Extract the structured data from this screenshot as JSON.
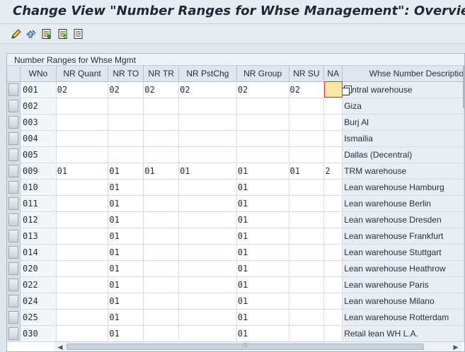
{
  "title": "Change View \"Number Ranges for Whse Management\": Overview",
  "toolbar": {
    "icons": [
      "pencil-glasses-icon",
      "other-view-icon",
      "details-icon",
      "select-all-icon",
      "deselect-icon"
    ]
  },
  "panel": {
    "title": "Number Ranges for Whse Mgmt",
    "columns": [
      "WNo",
      "NR Quant",
      "NR TO",
      "NR TR",
      "NR PstChg",
      "NR Group",
      "NR SU",
      "NA",
      "Whse Number Descriptio"
    ],
    "rows": [
      {
        "wno": "001",
        "nr_quant": "02",
        "nr_to": "02",
        "nr_tr": "02",
        "nr_pstchg": "02",
        "nr_group": "02",
        "nr_su": "02",
        "na": "",
        "desc": "ntral warehouse"
      },
      {
        "wno": "002",
        "nr_quant": "",
        "nr_to": "",
        "nr_tr": "",
        "nr_pstchg": "",
        "nr_group": "",
        "nr_su": "",
        "na": "",
        "desc": "Giza"
      },
      {
        "wno": "003",
        "nr_quant": "",
        "nr_to": "",
        "nr_tr": "",
        "nr_pstchg": "",
        "nr_group": "",
        "nr_su": "",
        "na": "",
        "desc": "Burj Al"
      },
      {
        "wno": "004",
        "nr_quant": "",
        "nr_to": "",
        "nr_tr": "",
        "nr_pstchg": "",
        "nr_group": "",
        "nr_su": "",
        "na": "",
        "desc": "Ismailia"
      },
      {
        "wno": "005",
        "nr_quant": "",
        "nr_to": "",
        "nr_tr": "",
        "nr_pstchg": "",
        "nr_group": "",
        "nr_su": "",
        "na": "",
        "desc": "Dallas (Decentral)"
      },
      {
        "wno": "009",
        "nr_quant": "01",
        "nr_to": "01",
        "nr_tr": "01",
        "nr_pstchg": "01",
        "nr_group": "01",
        "nr_su": "01",
        "na": "2",
        "desc": "TRM warehouse"
      },
      {
        "wno": "010",
        "nr_quant": "",
        "nr_to": "01",
        "nr_tr": "",
        "nr_pstchg": "",
        "nr_group": "01",
        "nr_su": "",
        "na": "",
        "desc": "Lean warehouse Hamburg"
      },
      {
        "wno": "011",
        "nr_quant": "",
        "nr_to": "01",
        "nr_tr": "",
        "nr_pstchg": "",
        "nr_group": "01",
        "nr_su": "",
        "na": "",
        "desc": "Lean warehouse Berlin"
      },
      {
        "wno": "012",
        "nr_quant": "",
        "nr_to": "01",
        "nr_tr": "",
        "nr_pstchg": "",
        "nr_group": "01",
        "nr_su": "",
        "na": "",
        "desc": "Lean warehouse Dresden"
      },
      {
        "wno": "013",
        "nr_quant": "",
        "nr_to": "01",
        "nr_tr": "",
        "nr_pstchg": "",
        "nr_group": "01",
        "nr_su": "",
        "na": "",
        "desc": "Lean warehouse Frankfurt"
      },
      {
        "wno": "014",
        "nr_quant": "",
        "nr_to": "01",
        "nr_tr": "",
        "nr_pstchg": "",
        "nr_group": "01",
        "nr_su": "",
        "na": "",
        "desc": "Lean warehouse Stuttgart"
      },
      {
        "wno": "020",
        "nr_quant": "",
        "nr_to": "01",
        "nr_tr": "",
        "nr_pstchg": "",
        "nr_group": "01",
        "nr_su": "",
        "na": "",
        "desc": "Lean warehouse Heathrow"
      },
      {
        "wno": "022",
        "nr_quant": "",
        "nr_to": "01",
        "nr_tr": "",
        "nr_pstchg": "",
        "nr_group": "01",
        "nr_su": "",
        "na": "",
        "desc": "Lean warehouse Paris"
      },
      {
        "wno": "024",
        "nr_quant": "",
        "nr_to": "01",
        "nr_tr": "",
        "nr_pstchg": "",
        "nr_group": "01",
        "nr_su": "",
        "na": "",
        "desc": "Lean warehouse Milano"
      },
      {
        "wno": "025",
        "nr_quant": "",
        "nr_to": "01",
        "nr_tr": "",
        "nr_pstchg": "",
        "nr_group": "01",
        "nr_su": "",
        "na": "",
        "desc": "Lean warehouse Rotterdam"
      },
      {
        "wno": "030",
        "nr_quant": "",
        "nr_to": "01",
        "nr_tr": "",
        "nr_pstchg": "",
        "nr_group": "01",
        "nr_su": "",
        "na": "",
        "desc": "Retail lean WH L.A."
      }
    ]
  },
  "colors": {
    "focus_cell": "#fbe8a6",
    "focus_border": "#d9363e",
    "desc_column": "#e8eef4"
  }
}
